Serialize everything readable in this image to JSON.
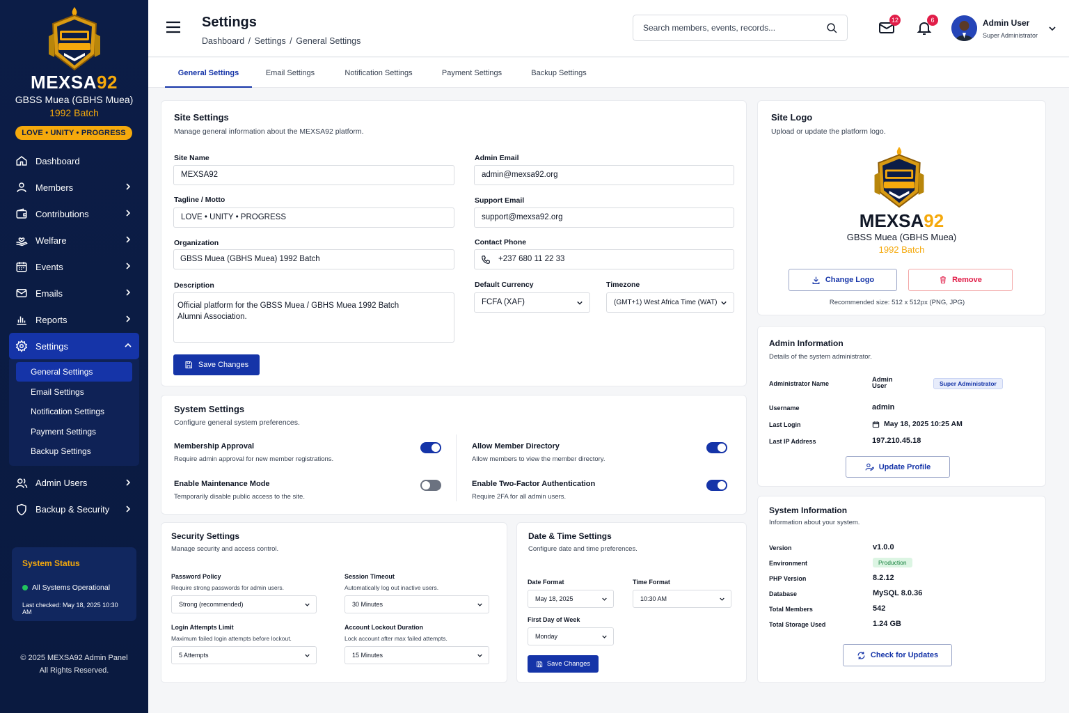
{
  "colors": {
    "primary": "#1534a8",
    "sidebar": "#0c1d47",
    "accent": "#f5a90c",
    "danger": "#e11d48",
    "success": "#22c55e"
  },
  "brand": {
    "name_main": "MEXSA",
    "name_year": "92",
    "org": "GBSS Muea (GBHS Muea)",
    "batch": "1992 Batch",
    "motto": "LOVE • UNITY • PROGRESS"
  },
  "sidebar": {
    "items": [
      {
        "label": "Dashboard",
        "icon": "home-icon"
      },
      {
        "label": "Members",
        "icon": "user-icon"
      },
      {
        "label": "Contributions",
        "icon": "wallet-icon"
      },
      {
        "label": "Welfare",
        "icon": "hand-heart-icon"
      },
      {
        "label": "Events",
        "icon": "calendar-icon"
      },
      {
        "label": "Emails",
        "icon": "mail-icon"
      },
      {
        "label": "Reports",
        "icon": "bar-chart-icon"
      },
      {
        "label": "Settings",
        "icon": "gear-icon"
      }
    ],
    "settings_sub": [
      "General Settings",
      "Email Settings",
      "Notification Settings",
      "Payment Settings",
      "Backup Settings"
    ],
    "items_after": [
      {
        "label": "Admin Users",
        "icon": "users-icon"
      },
      {
        "label": "Backup & Security",
        "icon": "shield-icon"
      }
    ],
    "status": {
      "title": "System Status",
      "text": "All Systems Operational",
      "checked": "Last checked: May 18, 2025 10:30 AM"
    },
    "copyright_1": "© 2025 MEXSA92 Admin Panel",
    "copyright_2": "All Rights Reserved."
  },
  "header": {
    "title": "Settings",
    "breadcrumb": [
      "Dashboard",
      "/",
      "Settings",
      "/",
      "General Settings"
    ],
    "search_placeholder": "Search members, events, records...",
    "mail_count": "12",
    "notif_count": "6",
    "user_name": "Admin User",
    "user_role": "Super Administrator"
  },
  "tabs": [
    "General Settings",
    "Email Settings",
    "Notification Settings",
    "Payment Settings",
    "Backup Settings"
  ],
  "site_settings": {
    "title": "Site Settings",
    "subtitle": "Manage general information about the MEXSA92 platform.",
    "site_name_label": "Site Name",
    "site_name": "MEXSA92",
    "tagline_label": "Tagline / Motto",
    "tagline": "LOVE • UNITY • PROGRESS",
    "org_label": "Organization",
    "org": "GBSS Muea (GBHS Muea) 1992 Batch",
    "desc_label": "Description",
    "desc_line1": "Official platform for the GBSS Muea / GBHS Muea 1992 Batch",
    "desc_line2": "Alumni Association.",
    "admin_email_label": "Admin Email",
    "admin_email": "admin@mexsa92.org",
    "support_email_label": "Support Email",
    "support_email": "support@mexsa92.org",
    "phone_label": "Contact Phone",
    "phone": "+237 680 11 22 33",
    "currency_label": "Default Currency",
    "currency": "FCFA (XAF)",
    "timezone_label": "Timezone",
    "timezone": "(GMT+1) West Africa Time (WAT)",
    "save": "Save Changes"
  },
  "system_settings": {
    "title": "System Settings",
    "subtitle": "Configure general system preferences.",
    "items": [
      {
        "title": "Membership Approval",
        "desc": "Require admin approval for new member registrations.",
        "on": true
      },
      {
        "title": "Allow Member Directory",
        "desc": "Allow members to view the member directory.",
        "on": true
      },
      {
        "title": "Enable Maintenance Mode",
        "desc": "Temporarily disable public access to the site.",
        "on": false
      },
      {
        "title": "Enable Two-Factor Authentication",
        "desc": "Require 2FA for all admin users.",
        "on": true
      }
    ]
  },
  "security_settings": {
    "title": "Security Settings",
    "subtitle": "Manage security and access control.",
    "password_label": "Password Policy",
    "password_desc": "Require strong passwords for admin users.",
    "password_value": "Strong (recommended)",
    "session_label": "Session Timeout",
    "session_desc": "Automatically log out inactive users.",
    "session_value": "30 Minutes",
    "attempts_label": "Login Attempts Limit",
    "attempts_desc": "Maximum failed login attempts before lockout.",
    "attempts_value": "5 Attempts",
    "lockout_label": "Account Lockout Duration",
    "lockout_desc": "Lock account after max failed attempts.",
    "lockout_value": "15 Minutes"
  },
  "datetime_settings": {
    "title": "Date & Time Settings",
    "subtitle": "Configure date and time preferences.",
    "date_format_label": "Date Format",
    "date_format": "May 18, 2025",
    "time_format_label": "Time Format",
    "time_format": "10:30 AM",
    "first_day_label": "First Day of Week",
    "first_day": "Monday",
    "save": "Save Changes"
  },
  "site_logo": {
    "title": "Site Logo",
    "subtitle": "Upload or update the platform logo.",
    "name_main": "MEXSA",
    "name_year": "92",
    "org": "GBSS Muea (GBHS Muea)",
    "batch": "1992 Batch",
    "change": "Change Logo",
    "remove": "Remove",
    "recommended": "Recommended size: 512 x 512px (PNG, JPG)"
  },
  "admin_info": {
    "title": "Admin Information",
    "subtitle": "Details of the system administrator.",
    "name_label": "Administrator Name",
    "name_value_1": "Admin",
    "name_value_2": "User",
    "role_tag": "Super Administrator",
    "username_label": "Username",
    "username": "admin",
    "last_login_label": "Last Login",
    "last_login": "May 18, 2025 10:25 AM",
    "ip_label": "Last IP Address",
    "ip": "197.210.45.18",
    "update": "Update Profile"
  },
  "system_info": {
    "title": "System Information",
    "subtitle": "Information about your system.",
    "version_label": "Version",
    "version": "v1.0.0",
    "env_label": "Environment",
    "env": "Production",
    "php_label": "PHP Version",
    "php": "8.2.12",
    "db_label": "Database",
    "db": "MySQL 8.0.36",
    "members_label": "Total Members",
    "members": "542",
    "storage_label": "Total Storage Used",
    "storage": "1.24 GB",
    "check": "Check for Updates"
  }
}
